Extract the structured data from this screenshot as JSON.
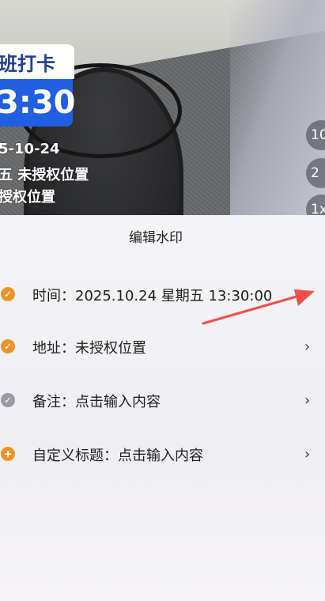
{
  "watermark": {
    "header": "班打卡",
    "time": "3:30",
    "date": "5-10-24",
    "line_weekday_location": "五  未授权位置",
    "line_location": "授权位置"
  },
  "zoom": [
    "10",
    "2",
    "1x"
  ],
  "sheet": {
    "title": "编辑水印",
    "rows": [
      {
        "label": "时间：2025.10.24 星期五 13:30:00",
        "icon": "check-icon",
        "color": "#e6962c"
      },
      {
        "label": "地址：未授权位置",
        "icon": "check-icon",
        "color": "#e6962c"
      },
      {
        "label": "备注：点击输入内容",
        "icon": "check-icon",
        "color": "#9a9aa2"
      },
      {
        "label": "自定义标题：点击输入内容",
        "icon": "plus-icon",
        "color": "#e6962c"
      }
    ],
    "chevron": "›"
  },
  "annotation": {
    "arrow_color": "#f0504a"
  }
}
